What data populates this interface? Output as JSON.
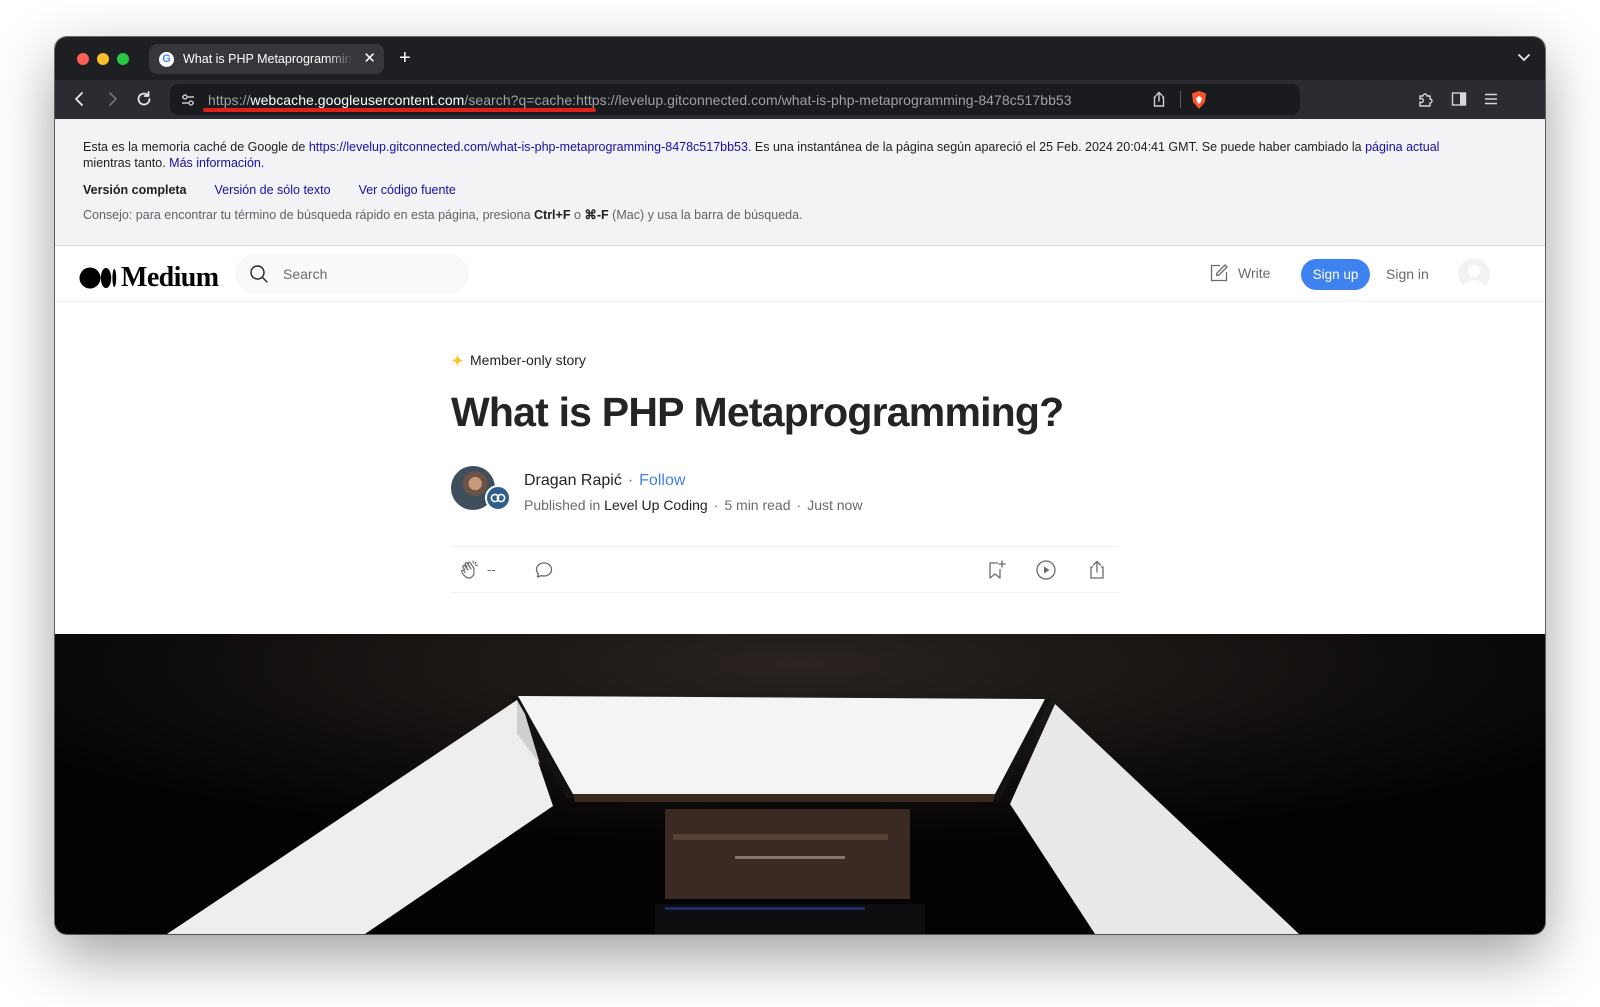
{
  "browser": {
    "tab_title": "What is PHP Metaprogramming?",
    "tab_favicon_letter": "G",
    "close_glyph": "✕",
    "new_tab_glyph": "+",
    "url_scheme": "https://",
    "url_host": "webcache.googleusercontent.com",
    "url_rest": "/search?q=cache:https://levelup.gitconnected.com/what-is-php-metaprogramming-8478c517bb53"
  },
  "cache_banner": {
    "intro": "Esta es la memoria caché de Google de ",
    "cached_url": "https://levelup.gitconnected.com/what-is-php-metaprogramming-8478c517bb53",
    "snapshot_text": ". Es una instantánea de la página según apareció el 25 Feb. 2024 20:04:41 GMT. Se puede haber cambiado la ",
    "current_page_link": "página actual",
    "meanwhile": "mientras tanto. ",
    "more_info_link": "Más información.",
    "full_version": "Versión completa",
    "text_only_link": "Versión de sólo texto",
    "source_link": "Ver código fuente",
    "tip_prefix": "Consejo: para encontrar tu término de búsqueda rápido en esta página, presiona ",
    "tip_key1": "Ctrl+F",
    "tip_or": " o ",
    "tip_key2": "⌘-F",
    "tip_suffix": " (Mac) y usa la barra de búsqueda."
  },
  "medium_header": {
    "logo_text": "Medium",
    "search_placeholder": "Search",
    "write_label": "Write",
    "signup_label": "Sign up",
    "signin_label": "Sign in"
  },
  "article": {
    "member_label": "Member-only story",
    "title": "What is PHP Metaprogramming?",
    "author": "Dragan Rapić",
    "dot": "·",
    "follow_label": "Follow",
    "published_in": "Published in ",
    "publication": "Level Up Coding",
    "read_time": "5 min read",
    "published_time": "Just now",
    "clap_count": "--"
  },
  "colors": {
    "accent_blue": "#3e82f0",
    "cache_link": "#1a0dab",
    "url_underline": "#e0211a",
    "member_star": "#ffc017"
  }
}
